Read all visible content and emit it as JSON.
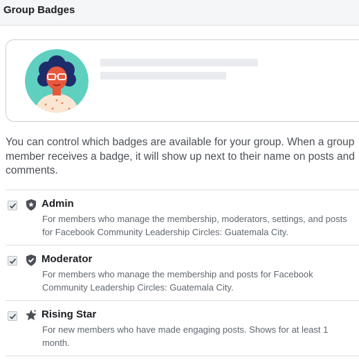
{
  "header": {
    "title": "Group Badges"
  },
  "description": "You can control which badges are available for your group. When a group member receives a badge, it will show up next to their name on posts and comments.",
  "badges": [
    {
      "title": "Admin",
      "description": "For members who manage the membership, moderators, settings, and posts for Facebook Community Leadership Circles: Guatemala City.",
      "checked": true,
      "icon": "admin-shield-star-icon"
    },
    {
      "title": "Moderator",
      "description": "For members who manage the membership and posts for Facebook Community Leadership Circles: Guatemala City.",
      "checked": true,
      "icon": "moderator-shield-check-icon"
    },
    {
      "title": "Rising Star",
      "description": "For new members who have made engaging posts. Shows for at least 1 month.",
      "checked": true,
      "icon": "rising-star-icon"
    }
  ],
  "colors": {
    "header_bg": "#f5f6f7",
    "avatar_bg": "#5fcfc0",
    "badge_icon": "#4b4f56",
    "divider": "#dddfe2"
  }
}
